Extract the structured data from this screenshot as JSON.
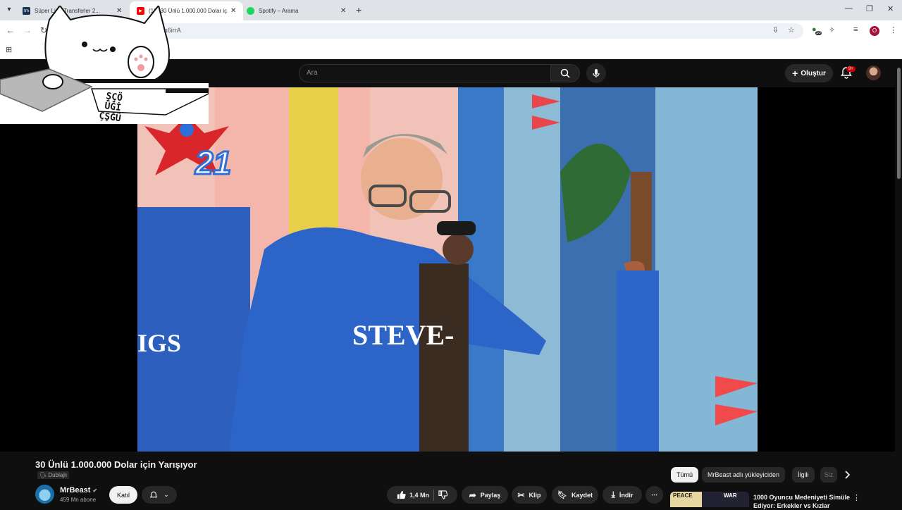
{
  "browser": {
    "tabs": [
      {
        "title": "Süper Lig - Transferler 2...",
        "favicon": "transfermarkt-icon",
        "color": "#1a3151"
      },
      {
        "title": "(12) 30 Ünlü 1.000.000 Dolar iç...",
        "favicon": "youtube-icon",
        "color": "#ff0000",
        "active": true
      },
      {
        "title": "Spotify – Arama",
        "favicon": "spotify-icon",
        "color": "#1ed760"
      }
    ],
    "url": "h?v=O0an6irrA",
    "profile_initial": "O",
    "extension_badge": "10"
  },
  "youtube": {
    "search_placeholder": "Ara",
    "create_label": "Oluştur",
    "notif_count": "9+",
    "video": {
      "title": "30 Ünlü 1.000.000 Dolar için Yarışıyor",
      "dub_label": "Dublajlı",
      "jersey_text": "STEVE-",
      "left_jersey_text": "IGS",
      "logo_number": "21"
    },
    "channel": {
      "name": "MrBeast",
      "subs": "459 Mn abone",
      "join_label": "Katıl"
    },
    "actions": {
      "likes": "1,4 Mn",
      "share": "Paylaş",
      "clip": "Klip",
      "save": "Kaydet",
      "download": "İndir"
    },
    "chips": [
      "Tümü",
      "MrBeast adlı yükleyiciden",
      "İlgili",
      "Siz"
    ],
    "recommended": {
      "title": "1000 Oyuncu Medeniyeti Simüle Ediyor: Erkekler vs Kızlar",
      "thumb_left": "PEACE",
      "thumb_right": "WAR"
    }
  },
  "sticker": {
    "keys": [
      "ŞÇÖ",
      "ÜĞİ",
      "ÇŞĞÜ"
    ]
  }
}
